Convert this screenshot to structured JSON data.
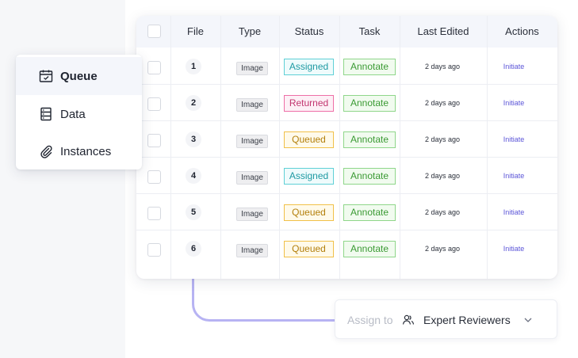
{
  "table": {
    "headers": {
      "file": "File",
      "type": "Type",
      "status": "Status",
      "task": "Task",
      "last_edited": "Last Edited",
      "actions": "Actions"
    },
    "rows": [
      {
        "file": "1",
        "type": "Image",
        "status": "Assigned",
        "task": "Annotate",
        "last_edited": "2 days ago",
        "action": "Initiate"
      },
      {
        "file": "2",
        "type": "Image",
        "status": "Returned",
        "task": "Annotate",
        "last_edited": "2 days ago",
        "action": "Initiate"
      },
      {
        "file": "3",
        "type": "Image",
        "status": "Queued",
        "task": "Annotate",
        "last_edited": "2 days ago",
        "action": "Initiate"
      },
      {
        "file": "4",
        "type": "Image",
        "status": "Assigned",
        "task": "Annotate",
        "last_edited": "2 days ago",
        "action": "Initiate"
      },
      {
        "file": "5",
        "type": "Image",
        "status": "Queued",
        "task": "Annotate",
        "last_edited": "2 days ago",
        "action": "Initiate"
      },
      {
        "file": "6",
        "type": "Image",
        "status": "Queued",
        "task": "Annotate",
        "last_edited": "2 days ago",
        "action": "Initiate"
      }
    ]
  },
  "status_colors": {
    "Assigned": {
      "border": "#5fd0d6",
      "bg": "#effbfc",
      "text": "#1e9aa3"
    },
    "Returned": {
      "border": "#ee6fa7",
      "bg": "#fdf0f6",
      "text": "#c2356f"
    },
    "Queued": {
      "border": "#f1c048",
      "bg": "#fffaea",
      "text": "#b37f0b"
    }
  },
  "menu": {
    "items": [
      {
        "label": "Queue",
        "icon": "calendar-check-icon",
        "active": true
      },
      {
        "label": "Data",
        "icon": "database-icon",
        "active": false
      },
      {
        "label": "Instances",
        "icon": "paperclip-icon",
        "active": false
      }
    ]
  },
  "assign": {
    "label": "Assign to",
    "value": "Expert Reviewers",
    "icon": "users-icon"
  }
}
